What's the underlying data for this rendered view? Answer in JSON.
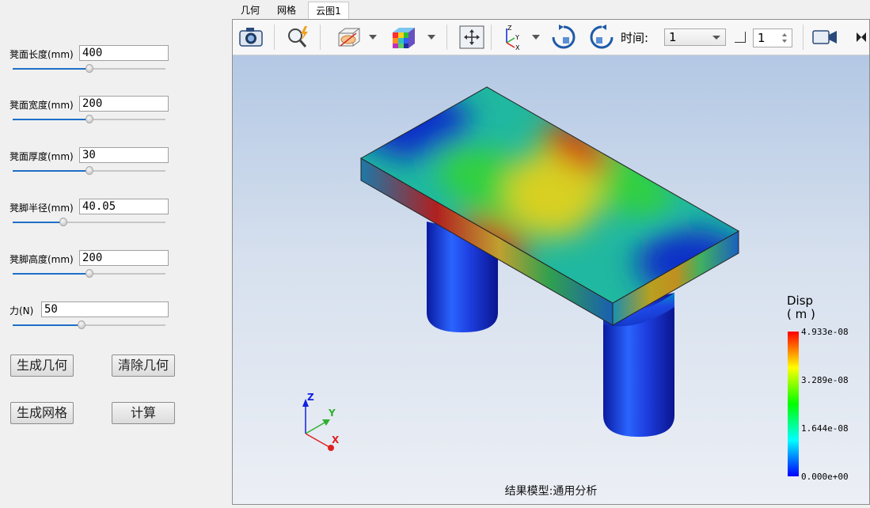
{
  "params": [
    {
      "label": "凳面长度(mm)",
      "value": "400",
      "slider": 0.5
    },
    {
      "label": "凳面宽度(mm)",
      "value": "200",
      "slider": 0.5
    },
    {
      "label": "凳面厚度(mm)",
      "value": "30",
      "slider": 0.5
    },
    {
      "label": "凳脚半径(mm)",
      "value": "40.05",
      "slider": 0.33
    },
    {
      "label": "凳脚高度(mm)",
      "value": "200",
      "slider": 0.5
    },
    {
      "label": "力(N)",
      "value": "50",
      "slider": 0.45
    }
  ],
  "buttons": {
    "gen_geometry": "生成几何",
    "clear_geometry": "清除几何",
    "gen_mesh": "生成网格",
    "compute": "计算"
  },
  "tabs": [
    {
      "label": "几何",
      "active": false
    },
    {
      "label": "网格",
      "active": false
    },
    {
      "label": "云图1",
      "active": true
    }
  ],
  "toolbar": {
    "time_label": "时间:",
    "time_value": "1",
    "step_value": "1",
    "icons": [
      "camera-icon",
      "probe-icon",
      "section-icon",
      "color-cube-icon",
      "fit-view-icon",
      "axis-orientation-icon",
      "rotate-cw-icon",
      "rotate-ccw-icon",
      "record-icon",
      "overflow-icon"
    ]
  },
  "legend": {
    "title_line1": "Disp",
    "title_line2": "( m )",
    "values": [
      "4.933e-08",
      "3.289e-08",
      "1.644e-08",
      "0.000e+00"
    ],
    "colors": [
      "#ff0000",
      "#ffff00",
      "#00ff00",
      "#00ffff",
      "#0000ff"
    ]
  },
  "triad": {
    "x": "X",
    "y": "Y",
    "z": "Z",
    "x_color": "#e02020",
    "y_color": "#30c030",
    "z_color": "#1020e0"
  },
  "model_name": "结果模型:通用分析"
}
